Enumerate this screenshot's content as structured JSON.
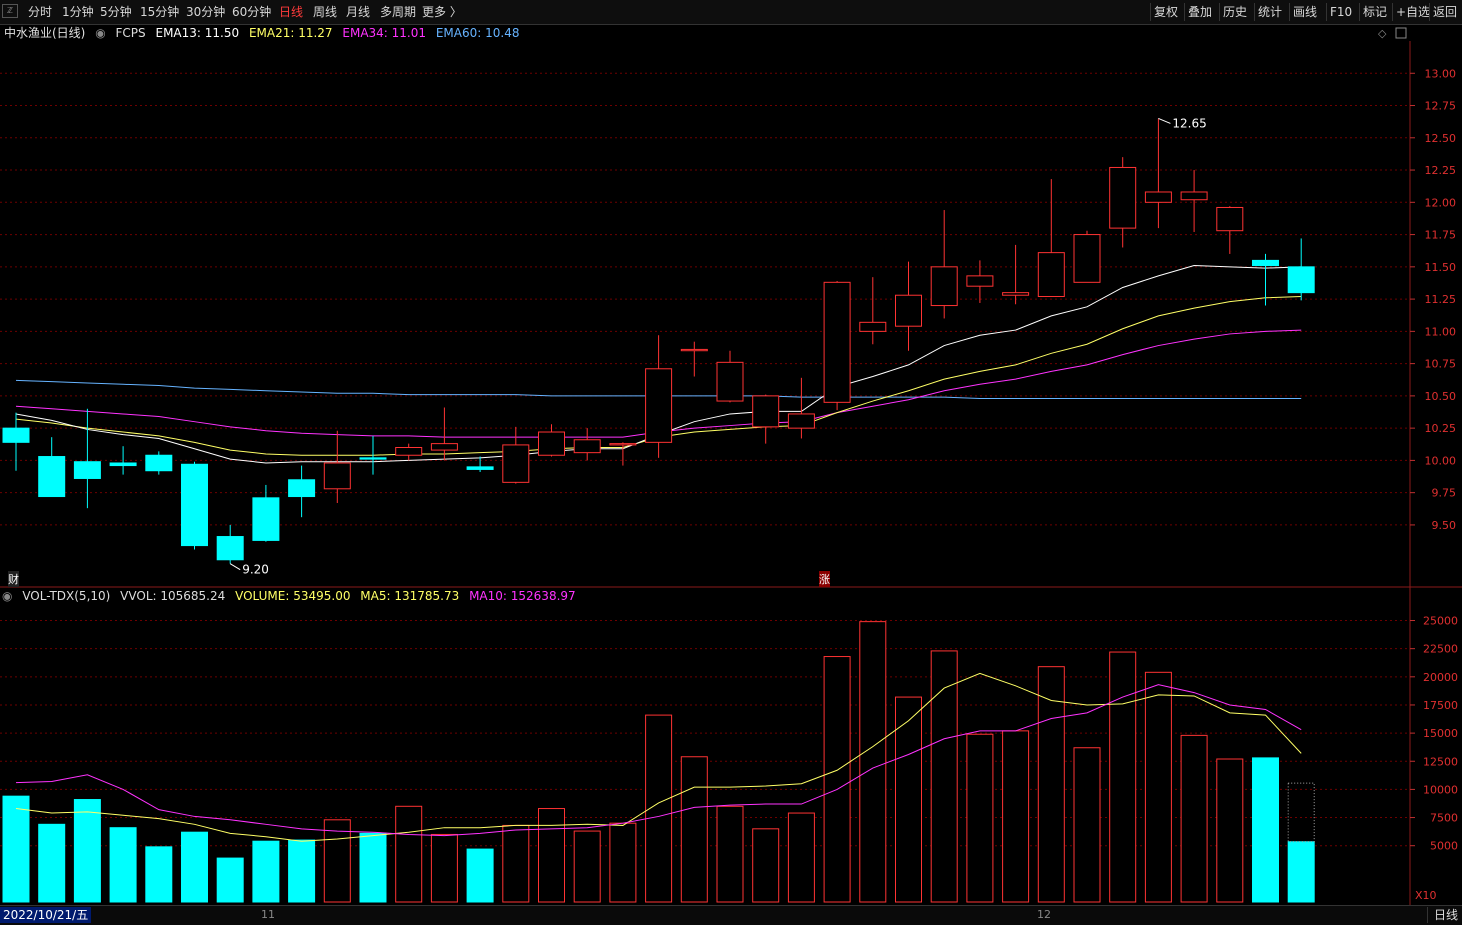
{
  "toolbar": {
    "corner_icon": "window-control-icon",
    "periods": [
      "分时",
      "1分钟",
      "5分钟",
      "15分钟",
      "30分钟",
      "60分钟",
      "日线",
      "周线",
      "月线",
      "多周期",
      "更多 〉"
    ],
    "active_period": "日线",
    "right_buttons": [
      "复权",
      "叠加",
      "历史",
      "统计",
      "画线",
      "F10",
      "标记",
      "+自选",
      "返回"
    ]
  },
  "price_panel": {
    "stock_name": "中水渔业(日线)",
    "indicator": "FCPS",
    "ema13": "EMA13: 11.50",
    "ema21": "EMA21: 11.27",
    "ema34": "EMA34: 11.01",
    "ema60": "EMA60: 10.48",
    "high_label": "12.65",
    "low_label": "9.20",
    "fin_marker": "财",
    "up_marker": "涨"
  },
  "volume_panel": {
    "indicator": "VOL-TDX(5,10)",
    "vvol": "VVOL: 105685.24",
    "volume": "VOLUME: 53495.00",
    "ma5": "MA5: 131785.73",
    "ma10": "MA10: 152638.97",
    "multiplier": "X10"
  },
  "bottom": {
    "date": "2022/10/21/五",
    "month_11": "11",
    "month_12": "12",
    "period": "日线"
  },
  "colors": {
    "up": "#ff3333",
    "down": "#00ffff",
    "ema13": "#ffffff",
    "ema21": "#ffff66",
    "ema34": "#ff33ff",
    "ema60": "#66b3ff",
    "grid": "#6e0000"
  },
  "chart_data": {
    "type": "candlestick",
    "price_ticks": [
      "13.00",
      "12.75",
      "12.50",
      "12.25",
      "12.00",
      "11.75",
      "11.50",
      "11.25",
      "11.00",
      "10.75",
      "10.50",
      "10.25",
      "10.00",
      "9.75",
      "9.50"
    ],
    "price_ylim": [
      9.05,
      13.25
    ],
    "volume_ticks": [
      "25000",
      "22500",
      "20000",
      "17500",
      "15000",
      "12500",
      "10000",
      "7500",
      "5000"
    ],
    "volume_ylim": [
      0,
      27000
    ],
    "candles": [
      {
        "o": 10.25,
        "h": 10.37,
        "l": 9.92,
        "c": 10.14
      },
      {
        "o": 10.03,
        "h": 10.18,
        "l": 9.72,
        "c": 9.72
      },
      {
        "o": 9.99,
        "h": 10.4,
        "l": 9.63,
        "c": 9.86
      },
      {
        "o": 9.98,
        "h": 10.11,
        "l": 9.89,
        "c": 9.96
      },
      {
        "o": 10.04,
        "h": 10.07,
        "l": 9.89,
        "c": 9.92
      },
      {
        "o": 9.97,
        "h": 9.99,
        "l": 9.31,
        "c": 9.34
      },
      {
        "o": 9.41,
        "h": 9.5,
        "l": 9.2,
        "c": 9.23
      },
      {
        "o": 9.71,
        "h": 9.81,
        "l": 9.37,
        "c": 9.38
      },
      {
        "o": 9.85,
        "h": 9.96,
        "l": 9.56,
        "c": 9.72
      },
      {
        "o": 9.78,
        "h": 10.23,
        "l": 9.67,
        "c": 9.98
      },
      {
        "o": 10.02,
        "h": 10.19,
        "l": 9.89,
        "c": 10.01
      },
      {
        "o": 10.04,
        "h": 10.13,
        "l": 10.0,
        "c": 10.1
      },
      {
        "o": 10.08,
        "h": 10.41,
        "l": 10.0,
        "c": 10.13
      },
      {
        "o": 9.95,
        "h": 10.03,
        "l": 9.91,
        "c": 9.93
      },
      {
        "o": 9.83,
        "h": 10.26,
        "l": 9.82,
        "c": 10.12
      },
      {
        "o": 10.04,
        "h": 10.28,
        "l": 10.03,
        "c": 10.22
      },
      {
        "o": 10.06,
        "h": 10.25,
        "l": 10.0,
        "c": 10.16
      },
      {
        "o": 10.12,
        "h": 10.14,
        "l": 9.96,
        "c": 10.13
      },
      {
        "o": 10.14,
        "h": 10.97,
        "l": 10.02,
        "c": 10.71
      },
      {
        "o": 10.85,
        "h": 10.92,
        "l": 10.65,
        "c": 10.86
      },
      {
        "o": 10.46,
        "h": 10.85,
        "l": 10.45,
        "c": 10.76
      },
      {
        "o": 10.26,
        "h": 10.51,
        "l": 10.13,
        "c": 10.5
      },
      {
        "o": 10.25,
        "h": 10.64,
        "l": 10.17,
        "c": 10.36
      },
      {
        "o": 10.45,
        "h": 11.39,
        "l": 10.39,
        "c": 11.38
      },
      {
        "o": 11.0,
        "h": 11.42,
        "l": 10.9,
        "c": 11.07
      },
      {
        "o": 11.04,
        "h": 11.54,
        "l": 10.85,
        "c": 11.28
      },
      {
        "o": 11.2,
        "h": 11.94,
        "l": 11.1,
        "c": 11.5
      },
      {
        "o": 11.35,
        "h": 11.55,
        "l": 11.22,
        "c": 11.43
      },
      {
        "o": 11.28,
        "h": 11.67,
        "l": 11.21,
        "c": 11.3
      },
      {
        "o": 11.27,
        "h": 12.18,
        "l": 11.27,
        "c": 11.61
      },
      {
        "o": 11.38,
        "h": 11.78,
        "l": 11.38,
        "c": 11.75
      },
      {
        "o": 11.8,
        "h": 12.35,
        "l": 11.65,
        "c": 12.27
      },
      {
        "o": 12.0,
        "h": 12.65,
        "l": 11.8,
        "c": 12.08
      },
      {
        "o": 12.02,
        "h": 12.25,
        "l": 11.77,
        "c": 12.08
      },
      {
        "o": 11.78,
        "h": 11.97,
        "l": 11.6,
        "c": 11.96
      },
      {
        "o": 11.55,
        "h": 11.6,
        "l": 11.2,
        "c": 11.51
      },
      {
        "o": 11.5,
        "h": 11.72,
        "l": 11.24,
        "c": 11.3
      }
    ],
    "volumes": [
      9400,
      6900,
      9100,
      6600,
      4900,
      6200,
      3900,
      5400,
      5500,
      7300,
      6100,
      8500,
      6000,
      4700,
      6800,
      8300,
      6300,
      7000,
      16600,
      12900,
      8500,
      6500,
      7900,
      21800,
      24900,
      18200,
      22300,
      14900,
      15200,
      20900,
      13700,
      22200,
      20400,
      14800,
      12700,
      12800,
      5350
    ],
    "ma5": [
      8300,
      7900,
      8000,
      7700,
      7400,
      6900,
      6100,
      5800,
      5400,
      5600,
      5900,
      6200,
      6600,
      6600,
      6800,
      6800,
      6900,
      6800,
      8800,
      10200,
      10200,
      10300,
      10500,
      11700,
      13800,
      16100,
      19000,
      20300,
      19200,
      17900,
      17500,
      17600,
      18400,
      18300,
      16800,
      16600,
      13200
    ],
    "ma10": [
      10600,
      10700,
      11300,
      10000,
      8200,
      7600,
      7300,
      6900,
      6500,
      6300,
      6200,
      6000,
      5900,
      6100,
      6400,
      6500,
      6600,
      7000,
      7600,
      8400,
      8600,
      8700,
      8700,
      10000,
      11900,
      13100,
      14500,
      15200,
      15200,
      16300,
      16800,
      18200,
      19300,
      18600,
      17500,
      17100,
      15300
    ],
    "ema13": [
      10.36,
      10.31,
      10.24,
      10.2,
      10.17,
      10.09,
      10.01,
      9.98,
      9.99,
      9.99,
      9.99,
      10.0,
      10.01,
      10.02,
      10.04,
      10.07,
      10.09,
      10.09,
      10.2,
      10.3,
      10.36,
      10.38,
      10.38,
      10.57,
      10.65,
      10.74,
      10.89,
      10.97,
      11.01,
      11.12,
      11.19,
      11.34,
      11.43,
      11.51,
      11.5,
      11.49,
      11.5
    ],
    "ema21": [
      10.32,
      10.29,
      10.25,
      10.22,
      10.19,
      10.14,
      10.08,
      10.05,
      10.04,
      10.04,
      10.04,
      10.05,
      10.05,
      10.06,
      10.07,
      10.09,
      10.1,
      10.1,
      10.18,
      10.22,
      10.24,
      10.26,
      10.27,
      10.37,
      10.46,
      10.54,
      10.63,
      10.69,
      10.74,
      10.83,
      10.9,
      11.02,
      11.12,
      11.18,
      11.23,
      11.26,
      11.27
    ],
    "ema34": [
      10.42,
      10.4,
      10.38,
      10.36,
      10.34,
      10.3,
      10.26,
      10.23,
      10.21,
      10.2,
      10.19,
      10.19,
      10.18,
      10.18,
      10.18,
      10.18,
      10.18,
      10.18,
      10.22,
      10.25,
      10.27,
      10.29,
      10.3,
      10.37,
      10.42,
      10.47,
      10.54,
      10.59,
      10.63,
      10.69,
      10.74,
      10.82,
      10.89,
      10.94,
      10.98,
      11.0,
      11.01
    ],
    "ema60": [
      10.62,
      10.61,
      10.6,
      10.59,
      10.58,
      10.56,
      10.55,
      10.54,
      10.53,
      10.52,
      10.52,
      10.51,
      10.51,
      10.51,
      10.51,
      10.5,
      10.5,
      10.5,
      10.5,
      10.5,
      10.5,
      10.5,
      10.49,
      10.49,
      10.49,
      10.49,
      10.49,
      10.48,
      10.48,
      10.48,
      10.48,
      10.48,
      10.48,
      10.48,
      10.48,
      10.48,
      10.48
    ]
  }
}
